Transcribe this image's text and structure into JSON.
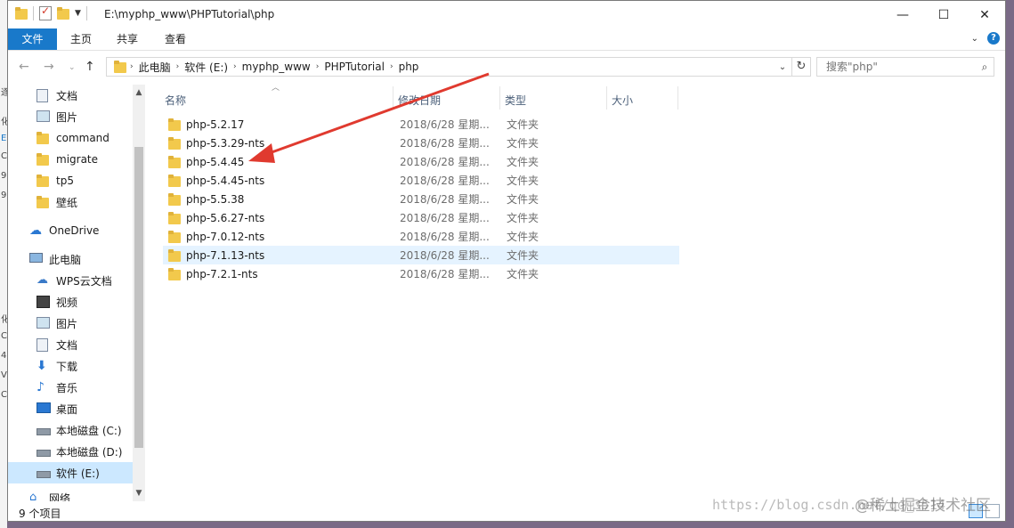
{
  "titlebar": {
    "path": "E:\\myphp_www\\PHPTutorial\\php",
    "minimize": "—",
    "maximize": "☐",
    "close": "✕"
  },
  "ribbon": {
    "tabs": [
      "文件",
      "主页",
      "共享",
      "查看"
    ],
    "accent": "#1979ca"
  },
  "address": {
    "crumbs": [
      "此电脑",
      "软件 (E:)",
      "myphp_www",
      "PHPTutorial",
      "php"
    ]
  },
  "search": {
    "placeholder": "搜索\"php\""
  },
  "nav": {
    "items": [
      {
        "label": "文档",
        "icon": "document-icon",
        "pinned": true
      },
      {
        "label": "图片",
        "icon": "picture-icon",
        "pinned": true
      },
      {
        "label": "command",
        "icon": "folder-icon"
      },
      {
        "label": "migrate",
        "icon": "folder-icon"
      },
      {
        "label": "tp5",
        "icon": "folder-icon"
      },
      {
        "label": "壁纸",
        "icon": "folder-icon"
      },
      {
        "label": "OneDrive",
        "icon": "cloud-icon"
      },
      {
        "label": "此电脑",
        "icon": "computer-icon"
      },
      {
        "label": "WPS云文档",
        "icon": "wps-cloud-icon"
      },
      {
        "label": "视频",
        "icon": "video-icon"
      },
      {
        "label": "图片",
        "icon": "picture-icon"
      },
      {
        "label": "文档",
        "icon": "document-icon"
      },
      {
        "label": "下载",
        "icon": "download-icon"
      },
      {
        "label": "音乐",
        "icon": "music-icon"
      },
      {
        "label": "桌面",
        "icon": "desktop-icon"
      },
      {
        "label": "本地磁盘 (C:)",
        "icon": "drive-icon"
      },
      {
        "label": "本地磁盘 (D:)",
        "icon": "drive-icon"
      },
      {
        "label": "软件 (E:)",
        "icon": "drive-icon",
        "selected": true
      },
      {
        "label": "网络",
        "icon": "network-icon"
      }
    ]
  },
  "columns": [
    "名称",
    "修改日期",
    "类型",
    "大小"
  ],
  "files": [
    {
      "name": "php-5.2.17",
      "date": "2018/6/28 星期...",
      "type": "文件夹"
    },
    {
      "name": "php-5.3.29-nts",
      "date": "2018/6/28 星期...",
      "type": "文件夹"
    },
    {
      "name": "php-5.4.45",
      "date": "2018/6/28 星期...",
      "type": "文件夹"
    },
    {
      "name": "php-5.4.45-nts",
      "date": "2018/6/28 星期...",
      "type": "文件夹"
    },
    {
      "name": "php-5.5.38",
      "date": "2018/6/28 星期...",
      "type": "文件夹"
    },
    {
      "name": "php-5.6.27-nts",
      "date": "2018/6/28 星期...",
      "type": "文件夹"
    },
    {
      "name": "php-7.0.12-nts",
      "date": "2018/6/28 星期...",
      "type": "文件夹"
    },
    {
      "name": "php-7.1.13-nts",
      "date": "2018/6/28 星期...",
      "type": "文件夹",
      "hovered": true
    },
    {
      "name": "php-7.2.1-nts",
      "date": "2018/6/28 星期...",
      "type": "文件夹"
    }
  ],
  "status": {
    "count": "9 个项目"
  },
  "watermark": {
    "url": "https://blog.csdn.net/qq_3514",
    "site": "@稀土掘金技术社区"
  },
  "annotation_color": "#e03a2f"
}
